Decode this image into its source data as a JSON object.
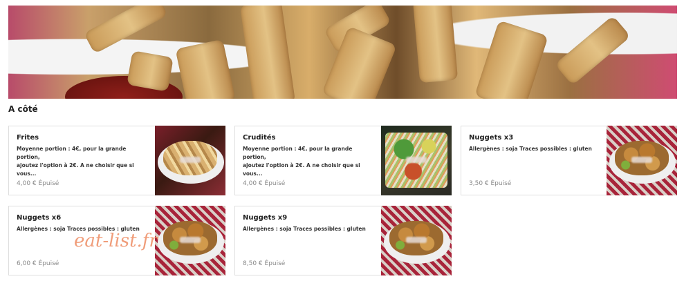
{
  "section": {
    "title": "A côté"
  },
  "watermark": "eat-list.fr",
  "products": [
    {
      "name": "Frites",
      "description": "Moyenne portion : 4€, pour la grande portion,\najoutez l'option à 2€. A ne choisir que si vous...",
      "price": "4,00 € Épuisé",
      "image": "fries-photo"
    },
    {
      "name": "Crudités",
      "description": "Moyenne portion : 4€, pour la grande portion,\najoutez l'option à 2€. A ne choisir que si vous...",
      "price": "4,00 € Épuisé",
      "image": "salad-photo"
    },
    {
      "name": "Nuggets x3",
      "description": "Allergènes : soja Traces possibles : gluten",
      "price": "3,50 € Épuisé",
      "image": "nuggets-photo"
    },
    {
      "name": "Nuggets x6",
      "description": "Allergènes : soja Traces possibles : gluten",
      "price": "6,00 € Épuisé",
      "image": "nuggets-photo"
    },
    {
      "name": "Nuggets x9",
      "description": "Allergènes : soja Traces possibles : gluten",
      "price": "8,50 € Épuisé",
      "image": "nuggets-photo"
    }
  ]
}
